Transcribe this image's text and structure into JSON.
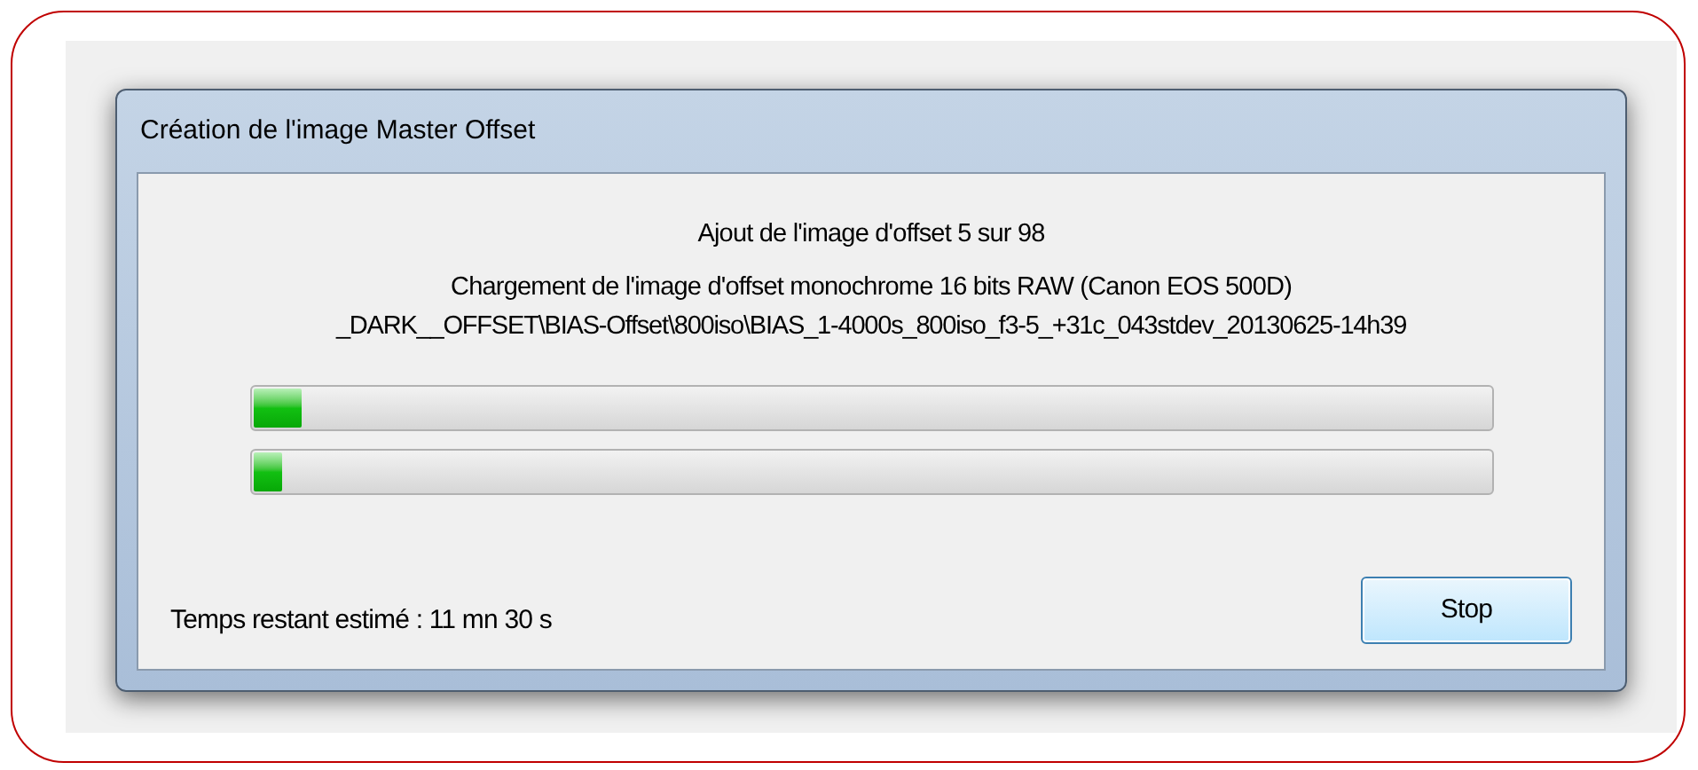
{
  "window": {
    "title": "Création de l'image Master Offset"
  },
  "status": {
    "line_1": "Ajout de l'image d'offset 5 sur 98",
    "line_2": "Chargement de l'image d'offset monochrome 16 bits RAW (Canon EOS 500D)",
    "line_3": "_DARK__OFFSET\\BIAS-Offset\\800iso\\BIAS_1-4000s_800iso_f3-5_+31c_043stdev_20130625-14h39"
  },
  "progress_bars": [
    {
      "level": 0.04
    },
    {
      "level": 0.023
    }
  ],
  "time_remaining": "Temps restant estimé : 11 mn 30 s",
  "buttons": [
    {
      "label": "Stop"
    }
  ]
}
